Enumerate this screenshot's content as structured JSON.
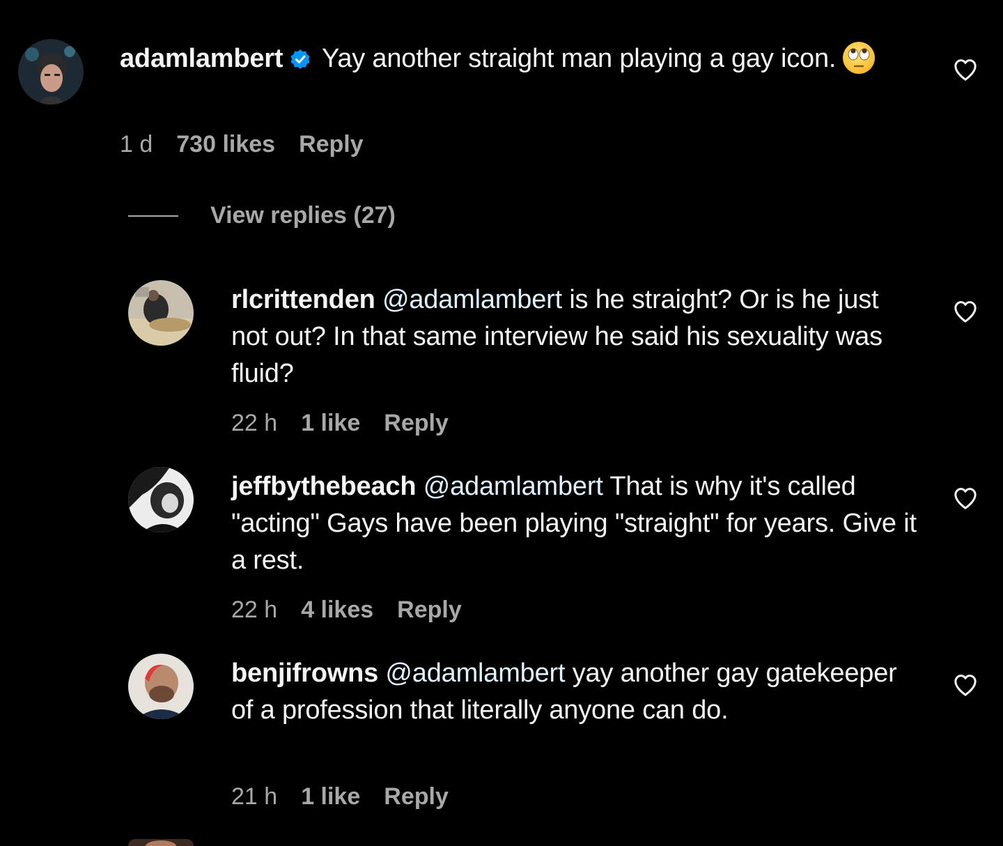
{
  "main_comment": {
    "username": "adamlambert",
    "text": "Yay another straight man playing a gay icon.",
    "emoji": "face-with-rolling-eyes",
    "time": "1 d",
    "likes": "730 likes",
    "reply_label": "Reply"
  },
  "view_replies_label": "View replies (27)",
  "replies": [
    {
      "username": "rlcrittenden",
      "mention": "@adamlambert",
      "text": "is he straight? Or is he just not out? In that same interview he said his sexuality was fluid?",
      "time": "22 h",
      "likes": "1 like",
      "reply_label": "Reply"
    },
    {
      "username": "jeffbythebeach",
      "mention": "@adamlambert",
      "text": "That is why it's called \"acting\" Gays have been playing \"straight\" for years. Give it a rest.",
      "time": "22 h",
      "likes": "4 likes",
      "reply_label": "Reply"
    },
    {
      "username": "benjifrowns",
      "mention": "@adamlambert",
      "text": "yay another gay gatekeeper of a profession that literally anyone can do.",
      "time": "21 h",
      "likes": "1 like",
      "reply_label": "Reply"
    }
  ],
  "colors": {
    "background": "#000000",
    "text": "#f5f5f5",
    "secondary": "#a8a8a8",
    "verified": "#0095f6"
  },
  "icons": {
    "like": "heart-outline-icon",
    "verified": "verified-badge-icon"
  }
}
